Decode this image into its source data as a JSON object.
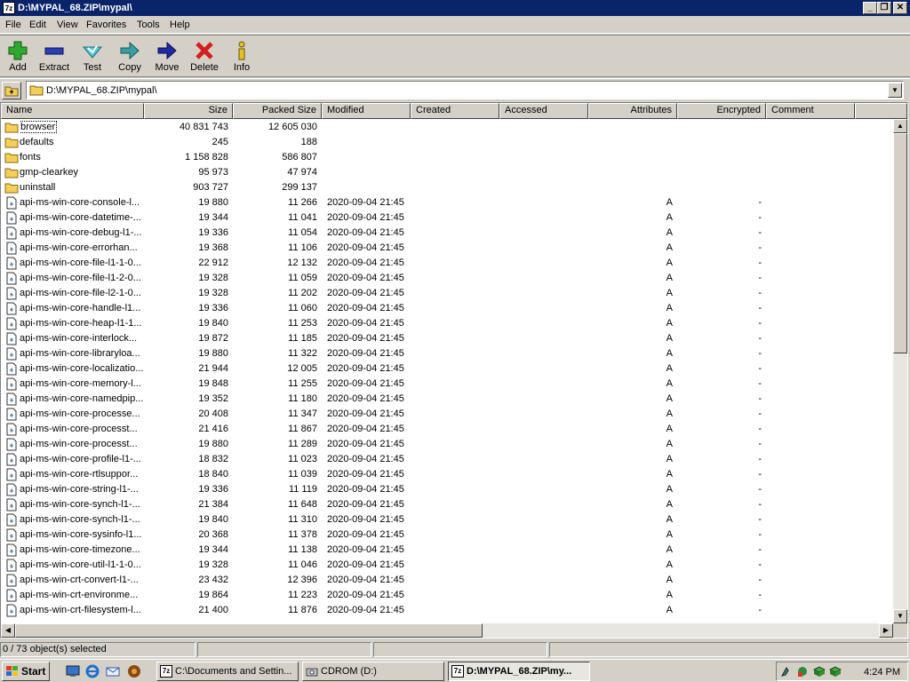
{
  "window": {
    "title": "D:\\MYPAL_68.ZIP\\mypal\\",
    "app_icon": "7z"
  },
  "menu": [
    "File",
    "Edit",
    "View",
    "Favorites",
    "Tools",
    "Help"
  ],
  "toolbar": [
    {
      "label": "Add",
      "icon": "plus-icon"
    },
    {
      "label": "Extract",
      "icon": "minus-icon"
    },
    {
      "label": "Test",
      "icon": "check-icon"
    },
    {
      "label": "Copy",
      "icon": "copy-arrow-icon"
    },
    {
      "label": "Move",
      "icon": "move-arrow-icon"
    },
    {
      "label": "Delete",
      "icon": "delete-x-icon"
    },
    {
      "label": "Info",
      "icon": "info-icon"
    }
  ],
  "address": {
    "path": "D:\\MYPAL_68.ZIP\\mypal\\"
  },
  "columns": [
    "Name",
    "Size",
    "Packed Size",
    "Modified",
    "Created",
    "Accessed",
    "Attributes",
    "Encrypted",
    "Comment"
  ],
  "rows": [
    {
      "type": "folder",
      "name": "browser",
      "size": "40 831 743",
      "packed": "12 605 030",
      "modified": "",
      "attr": "",
      "enc": ""
    },
    {
      "type": "folder",
      "name": "defaults",
      "size": "245",
      "packed": "188",
      "modified": "",
      "attr": "",
      "enc": ""
    },
    {
      "type": "folder",
      "name": "fonts",
      "size": "1 158 828",
      "packed": "586 807",
      "modified": "",
      "attr": "",
      "enc": ""
    },
    {
      "type": "folder",
      "name": "gmp-clearkey",
      "size": "95 973",
      "packed": "47 974",
      "modified": "",
      "attr": "",
      "enc": ""
    },
    {
      "type": "folder",
      "name": "uninstall",
      "size": "903 727",
      "packed": "299 137",
      "modified": "",
      "attr": "",
      "enc": ""
    },
    {
      "type": "file",
      "name": "api-ms-win-core-console-l...",
      "size": "19 880",
      "packed": "11 266",
      "modified": "2020-09-04 21:45",
      "attr": "A",
      "enc": "-"
    },
    {
      "type": "file",
      "name": "api-ms-win-core-datetime-...",
      "size": "19 344",
      "packed": "11 041",
      "modified": "2020-09-04 21:45",
      "attr": "A",
      "enc": "-"
    },
    {
      "type": "file",
      "name": "api-ms-win-core-debug-l1-...",
      "size": "19 336",
      "packed": "11 054",
      "modified": "2020-09-04 21:45",
      "attr": "A",
      "enc": "-"
    },
    {
      "type": "file",
      "name": "api-ms-win-core-errorhan...",
      "size": "19 368",
      "packed": "11 106",
      "modified": "2020-09-04 21:45",
      "attr": "A",
      "enc": "-"
    },
    {
      "type": "file",
      "name": "api-ms-win-core-file-l1-1-0...",
      "size": "22 912",
      "packed": "12 132",
      "modified": "2020-09-04 21:45",
      "attr": "A",
      "enc": "-"
    },
    {
      "type": "file",
      "name": "api-ms-win-core-file-l1-2-0...",
      "size": "19 328",
      "packed": "11 059",
      "modified": "2020-09-04 21:45",
      "attr": "A",
      "enc": "-"
    },
    {
      "type": "file",
      "name": "api-ms-win-core-file-l2-1-0...",
      "size": "19 328",
      "packed": "11 202",
      "modified": "2020-09-04 21:45",
      "attr": "A",
      "enc": "-"
    },
    {
      "type": "file",
      "name": "api-ms-win-core-handle-l1...",
      "size": "19 336",
      "packed": "11 060",
      "modified": "2020-09-04 21:45",
      "attr": "A",
      "enc": "-"
    },
    {
      "type": "file",
      "name": "api-ms-win-core-heap-l1-1...",
      "size": "19 840",
      "packed": "11 253",
      "modified": "2020-09-04 21:45",
      "attr": "A",
      "enc": "-"
    },
    {
      "type": "file",
      "name": "api-ms-win-core-interlock...",
      "size": "19 872",
      "packed": "11 185",
      "modified": "2020-09-04 21:45",
      "attr": "A",
      "enc": "-"
    },
    {
      "type": "file",
      "name": "api-ms-win-core-libraryloa...",
      "size": "19 880",
      "packed": "11 322",
      "modified": "2020-09-04 21:45",
      "attr": "A",
      "enc": "-"
    },
    {
      "type": "file",
      "name": "api-ms-win-core-localizatio...",
      "size": "21 944",
      "packed": "12 005",
      "modified": "2020-09-04 21:45",
      "attr": "A",
      "enc": "-"
    },
    {
      "type": "file",
      "name": "api-ms-win-core-memory-l...",
      "size": "19 848",
      "packed": "11 255",
      "modified": "2020-09-04 21:45",
      "attr": "A",
      "enc": "-"
    },
    {
      "type": "file",
      "name": "api-ms-win-core-namedpip...",
      "size": "19 352",
      "packed": "11 180",
      "modified": "2020-09-04 21:45",
      "attr": "A",
      "enc": "-"
    },
    {
      "type": "file",
      "name": "api-ms-win-core-processe...",
      "size": "20 408",
      "packed": "11 347",
      "modified": "2020-09-04 21:45",
      "attr": "A",
      "enc": "-"
    },
    {
      "type": "file",
      "name": "api-ms-win-core-processt...",
      "size": "21 416",
      "packed": "11 867",
      "modified": "2020-09-04 21:45",
      "attr": "A",
      "enc": "-"
    },
    {
      "type": "file",
      "name": "api-ms-win-core-processt...",
      "size": "19 880",
      "packed": "11 289",
      "modified": "2020-09-04 21:45",
      "attr": "A",
      "enc": "-"
    },
    {
      "type": "file",
      "name": "api-ms-win-core-profile-l1-...",
      "size": "18 832",
      "packed": "11 023",
      "modified": "2020-09-04 21:45",
      "attr": "A",
      "enc": "-"
    },
    {
      "type": "file",
      "name": "api-ms-win-core-rtlsuppor...",
      "size": "18 840",
      "packed": "11 039",
      "modified": "2020-09-04 21:45",
      "attr": "A",
      "enc": "-"
    },
    {
      "type": "file",
      "name": "api-ms-win-core-string-l1-...",
      "size": "19 336",
      "packed": "11 119",
      "modified": "2020-09-04 21:45",
      "attr": "A",
      "enc": "-"
    },
    {
      "type": "file",
      "name": "api-ms-win-core-synch-l1-...",
      "size": "21 384",
      "packed": "11 648",
      "modified": "2020-09-04 21:45",
      "attr": "A",
      "enc": "-"
    },
    {
      "type": "file",
      "name": "api-ms-win-core-synch-l1-...",
      "size": "19 840",
      "packed": "11 310",
      "modified": "2020-09-04 21:45",
      "attr": "A",
      "enc": "-"
    },
    {
      "type": "file",
      "name": "api-ms-win-core-sysinfo-l1...",
      "size": "20 368",
      "packed": "11 378",
      "modified": "2020-09-04 21:45",
      "attr": "A",
      "enc": "-"
    },
    {
      "type": "file",
      "name": "api-ms-win-core-timezone...",
      "size": "19 344",
      "packed": "11 138",
      "modified": "2020-09-04 21:45",
      "attr": "A",
      "enc": "-"
    },
    {
      "type": "file",
      "name": "api-ms-win-core-util-l1-1-0...",
      "size": "19 328",
      "packed": "11 046",
      "modified": "2020-09-04 21:45",
      "attr": "A",
      "enc": "-"
    },
    {
      "type": "file",
      "name": "api-ms-win-crt-convert-l1-...",
      "size": "23 432",
      "packed": "12 396",
      "modified": "2020-09-04 21:45",
      "attr": "A",
      "enc": "-"
    },
    {
      "type": "file",
      "name": "api-ms-win-crt-environme...",
      "size": "19 864",
      "packed": "11 223",
      "modified": "2020-09-04 21:45",
      "attr": "A",
      "enc": "-"
    },
    {
      "type": "file",
      "name": "api-ms-win-crt-filesystem-l...",
      "size": "21 400",
      "packed": "11 876",
      "modified": "2020-09-04 21:45",
      "attr": "A",
      "enc": "-"
    }
  ],
  "status": {
    "selection": "0 / 73 object(s) selected"
  },
  "taskbar": {
    "start_label": "Start",
    "tasks": [
      {
        "label": "C:\\Documents and Settin...",
        "icon": "7z",
        "active": false
      },
      {
        "label": "CDROM (D:)",
        "icon": "cdrom-icon",
        "active": false
      },
      {
        "label": "D:\\MYPAL_68.ZIP\\my...",
        "icon": "7z",
        "active": true
      }
    ],
    "clock": "4:24 PM"
  },
  "colors": {
    "titlebar": "#0a246a",
    "face": "#d4d0c8",
    "folder": "#f2cf5a"
  }
}
